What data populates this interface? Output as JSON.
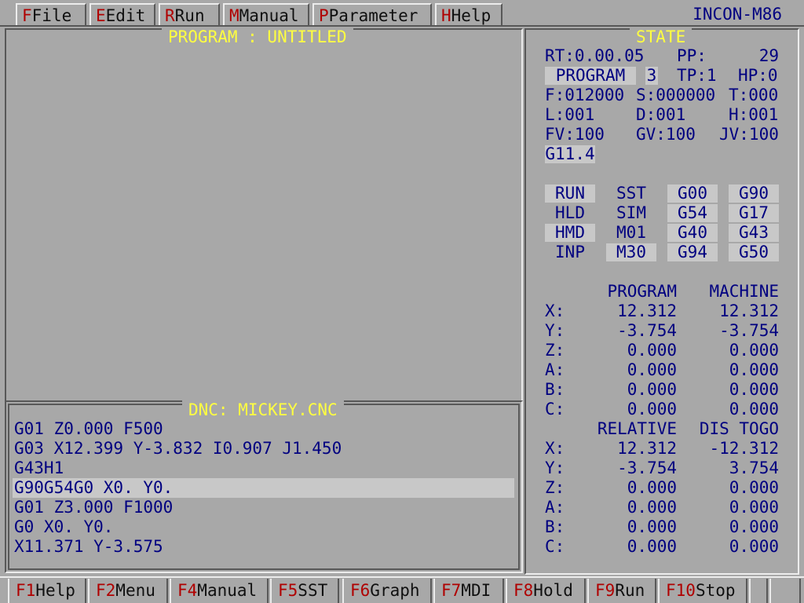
{
  "menu": [
    {
      "key": "F",
      "label": "File"
    },
    {
      "key": "E",
      "label": "Edit"
    },
    {
      "key": "R",
      "label": "Run"
    },
    {
      "key": "M",
      "label": "Manual"
    },
    {
      "key": "P",
      "label": "Parameter"
    },
    {
      "key": "H",
      "label": "Help"
    }
  ],
  "brand": "INCON-M86",
  "program_panel": {
    "title": "PROGRAM : UNTITLED"
  },
  "dnc_panel": {
    "title": "DNC: MICKEY.CNC",
    "lines": [
      "G01 Z0.000 F500",
      "G03 X12.399 Y-3.832 I0.907 J1.450",
      "G43H1",
      "G90G54G0 X0. Y0.",
      "G01 Z3.000 F1000",
      "G0 X0. Y0.",
      "X11.371 Y-3.575"
    ],
    "highlighted_index": 3
  },
  "state": {
    "title": "STATE",
    "rt": "RT:0.00.05",
    "pp_label": "PP:",
    "pp_value": "29",
    "program_label": "PROGRAM",
    "program_no": "3",
    "tp": "TP:1",
    "hp": "HP:0",
    "f": "F:012000",
    "s": "S:000000",
    "t": "T:000",
    "l": "L:001",
    "d": "D:001",
    "h": "H:001",
    "fv": "FV:100",
    "gv": "GV:100",
    "jv": "JV:100",
    "gcode": "G11.4",
    "modes": {
      "run": "RUN",
      "hld": "HLD",
      "hmd": "HMD",
      "inp": "INP",
      "sst": "SST",
      "sim": "SIM",
      "m01": "M01",
      "m30": "M30",
      "g00": "G00",
      "g54": "G54",
      "g40": "G40",
      "g94": "G94",
      "g90": "G90",
      "g17": "G17",
      "g43": "G43",
      "g50": "G50"
    },
    "coords_header": {
      "program": "PROGRAM",
      "machine": "MACHINE"
    },
    "coords": [
      {
        "axis": "X:",
        "program": "12.312",
        "machine": "12.312"
      },
      {
        "axis": "Y:",
        "program": "-3.754",
        "machine": "-3.754"
      },
      {
        "axis": "Z:",
        "program": "0.000",
        "machine": "0.000"
      },
      {
        "axis": "A:",
        "program": "0.000",
        "machine": "0.000"
      },
      {
        "axis": "B:",
        "program": "0.000",
        "machine": "0.000"
      },
      {
        "axis": "C:",
        "program": "0.000",
        "machine": "0.000"
      }
    ],
    "rel_header": {
      "relative": "RELATIVE",
      "distogo": "DIS TOGO"
    },
    "rel": [
      {
        "axis": "X:",
        "relative": "12.312",
        "distogo": "-12.312"
      },
      {
        "axis": "Y:",
        "relative": "-3.754",
        "distogo": "3.754"
      },
      {
        "axis": "Z:",
        "relative": "0.000",
        "distogo": "0.000"
      },
      {
        "axis": "A:",
        "relative": "0.000",
        "distogo": "0.000"
      },
      {
        "axis": "B:",
        "relative": "0.000",
        "distogo": "0.000"
      },
      {
        "axis": "C:",
        "relative": "0.000",
        "distogo": "0.000"
      }
    ]
  },
  "fkeys": [
    {
      "key": "F1",
      "label": "Help"
    },
    {
      "key": "F2",
      "label": "Menu"
    },
    {
      "key": "F4",
      "label": "Manual"
    },
    {
      "key": "F5",
      "label": "SST"
    },
    {
      "key": "F6",
      "label": "Graph"
    },
    {
      "key": "F7",
      "label": "MDI"
    },
    {
      "key": "F8",
      "label": "Hold"
    },
    {
      "key": "F9",
      "label": "Run"
    },
    {
      "key": "F10",
      "label": "Stop"
    }
  ]
}
